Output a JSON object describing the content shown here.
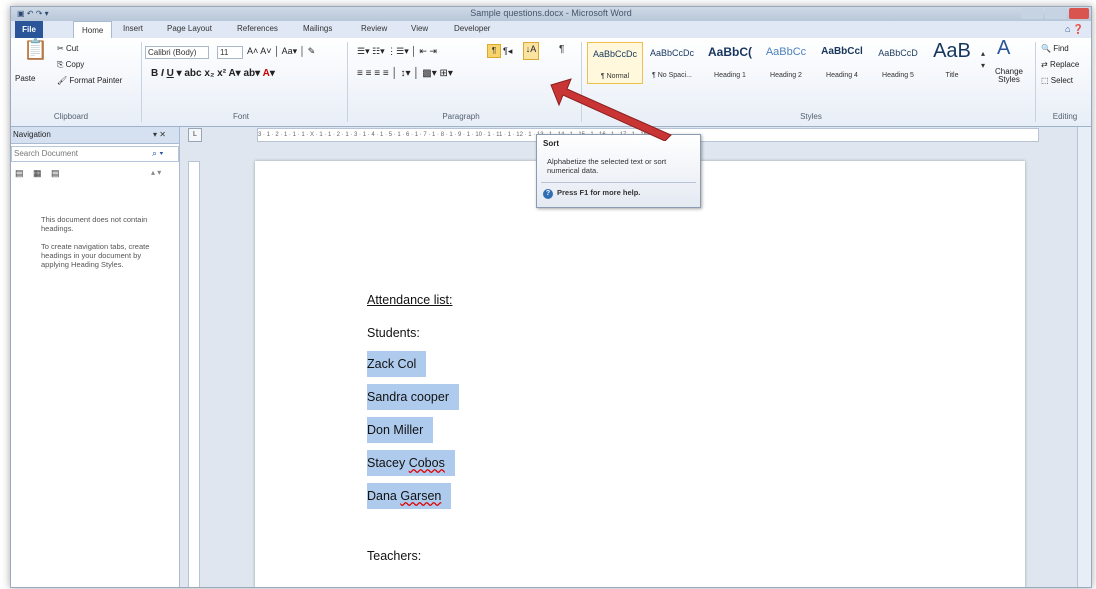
{
  "window": {
    "title": "Sample questions.docx - Microsoft Word"
  },
  "tabs": [
    "File",
    "Home",
    "Insert",
    "Page Layout",
    "References",
    "Mailings",
    "Review",
    "View",
    "Developer"
  ],
  "clipboard": {
    "paste": "Paste",
    "cut": "Cut",
    "copy": "Copy",
    "format_painter": "Format Painter",
    "group": "Clipboard"
  },
  "font": {
    "name": "Calibri (Body)",
    "size": "11",
    "group": "Font"
  },
  "paragraph": {
    "group": "Paragraph"
  },
  "styles": {
    "group": "Styles",
    "items": [
      {
        "sample": "AaBbCcDc",
        "name": "¶ Normal"
      },
      {
        "sample": "AaBbCcDc",
        "name": "¶ No Spaci..."
      },
      {
        "sample": "AaBbC(",
        "name": "Heading 1"
      },
      {
        "sample": "AaBbCc",
        "name": "Heading 2"
      },
      {
        "sample": "AaBbCcl",
        "name": "Heading 4"
      },
      {
        "sample": "AaBbCcD",
        "name": "Heading 5"
      },
      {
        "sample": "AaB",
        "name": "Title"
      }
    ],
    "change_styles": "Change Styles"
  },
  "editing": {
    "find": "Find",
    "replace": "Replace",
    "select": "Select",
    "group": "Editing"
  },
  "navigation": {
    "title": "Navigation",
    "search_placeholder": "Search Document",
    "msg1": "This document does not contain headings.",
    "msg2": "To create navigation tabs, create headings in your document by applying Heading Styles."
  },
  "tooltip": {
    "title": "Sort",
    "desc": "Alphabetize the selected text or sort numerical data.",
    "help": "Press F1 for more help."
  },
  "document": {
    "heading": "Attendance list:",
    "students_label": "Students:",
    "students": [
      {
        "first": "Zack Col",
        "last": ""
      },
      {
        "first": "Sandra cooper",
        "last": ""
      },
      {
        "first": "Don Miller",
        "last": ""
      },
      {
        "first": "Stacey ",
        "last": "Cobos"
      },
      {
        "first": "Dana ",
        "last": "Garsen"
      }
    ],
    "teachers_label": "Teachers:"
  },
  "ruler_text": "3 · 1 · 2 · 1 · 1 · 1 · X · 1 · 1 · 2 · 1 · 3 · 1 · 4 · 1 · 5 · 1 · 6 · 1 · 7 · 1 · 8 · 1 · 9 · 1 · 10 · 1 · 11 · 1 · 12 · 1 · 13 · 1 · 14 · 1 · 15 · 1 · 16 · 1 · 17 · 1 · 18"
}
